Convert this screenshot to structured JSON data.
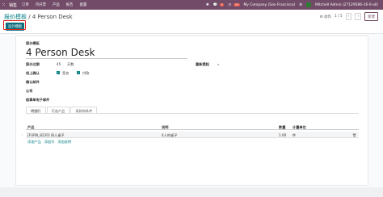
{
  "navbar": {
    "brand": "销售",
    "menu": [
      "订单",
      "待开票",
      "产品",
      "报告",
      "配置"
    ],
    "badge_chat": "5",
    "badge_activity": "29",
    "company": "My Company (San Francisco)",
    "user": "Mitchell Admin (27129586-16-0-all)"
  },
  "breadcrumb": {
    "parent": "报价模板",
    "separator": " / ",
    "current": "4 Person Desk"
  },
  "actions": {
    "gear": "⚙ 动作",
    "pager": "1 / 5",
    "prev": "‹",
    "next": "›",
    "new": "新建"
  },
  "design_button": "设计模板",
  "form": {
    "template_label": "报价模板",
    "template_name": "4 Person Desk",
    "validity_label": "报价过期",
    "validity_value": "45",
    "validity_unit": "天数",
    "online_confirm_label": "线上确认",
    "sign_label": "签名",
    "pay_label": "付款",
    "recurrence_label": "重新提起",
    "confirm_mail_label": "确认邮件",
    "company_label": "公司",
    "mailing_label": "结算单电子邮件"
  },
  "tabs": [
    "明细行",
    "可选产品",
    "条款和条件"
  ],
  "table": {
    "headers": [
      "产品",
      "说明",
      "数量",
      "计量单位"
    ],
    "rows": [
      {
        "product": "[FURN_8220] 四人桌子",
        "description": "4人的桌子",
        "qty": "1.00",
        "uom": "件"
      }
    ],
    "add_links": [
      "添加产品",
      "添加节",
      "添加说明"
    ]
  }
}
